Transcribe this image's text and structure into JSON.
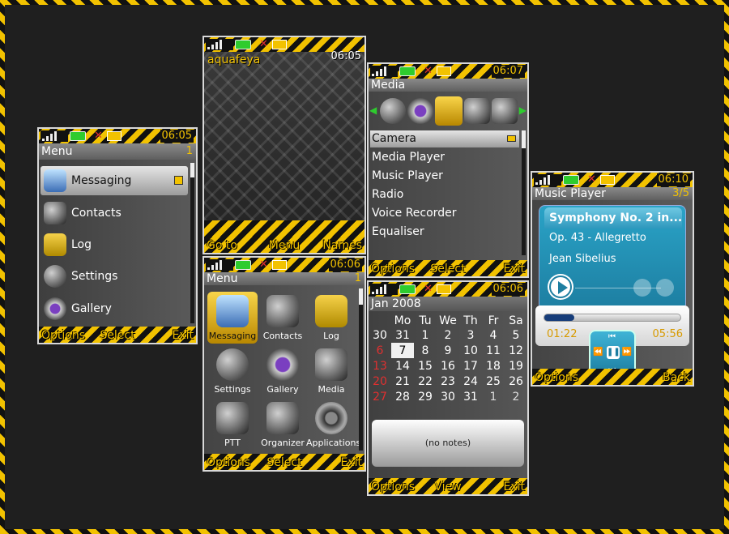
{
  "screen1": {
    "status_time": "06:05",
    "title": "Menu",
    "title_right": "1",
    "items": [
      {
        "label": "Messaging"
      },
      {
        "label": "Contacts"
      },
      {
        "label": "Log"
      },
      {
        "label": "Settings"
      },
      {
        "label": "Gallery"
      }
    ],
    "softkeys": {
      "left": "Options",
      "center": "Select",
      "right": "Exit"
    }
  },
  "screen2": {
    "status_time": "06:05",
    "operator": "aquafeya",
    "softkeys": {
      "left": "Go to",
      "center": "Menu",
      "right": "Names"
    }
  },
  "screen3": {
    "status_time": "06:06",
    "title": "Menu",
    "title_right": "1",
    "grid": [
      {
        "label": "Messaging"
      },
      {
        "label": "Contacts"
      },
      {
        "label": "Log"
      },
      {
        "label": "Settings"
      },
      {
        "label": "Gallery"
      },
      {
        "label": "Media"
      },
      {
        "label": "PTT"
      },
      {
        "label": "Organizer"
      },
      {
        "label": "Applications"
      }
    ],
    "softkeys": {
      "left": "Options",
      "center": "Select",
      "right": "Exit"
    }
  },
  "screen4": {
    "status_time": "06:07",
    "title": "Media",
    "items": [
      {
        "label": "Camera"
      },
      {
        "label": "Media Player"
      },
      {
        "label": "Music Player"
      },
      {
        "label": "Radio"
      },
      {
        "label": "Voice Recorder"
      },
      {
        "label": "Equaliser"
      }
    ],
    "softkeys": {
      "left": "Options",
      "center": "Select",
      "right": "Exit"
    }
  },
  "screen5": {
    "status_time": "06:06",
    "title": "Jan 2008",
    "weekdays": [
      "Mo",
      "Tu",
      "We",
      "Th",
      "Fr",
      "Sa"
    ],
    "weeks": [
      [
        "30",
        "31",
        "1",
        "2",
        "3",
        "4",
        "5"
      ],
      [
        "6",
        "7",
        "8",
        "9",
        "10",
        "11",
        "12"
      ],
      [
        "13",
        "14",
        "15",
        "16",
        "17",
        "18",
        "19"
      ],
      [
        "20",
        "21",
        "22",
        "23",
        "24",
        "25",
        "26"
      ],
      [
        "27",
        "28",
        "29",
        "30",
        "31",
        "1",
        "2"
      ]
    ],
    "notes": "(no notes)",
    "softkeys": {
      "left": "Options",
      "center": "View",
      "right": "Exit"
    }
  },
  "screen6": {
    "status_time": "06:10",
    "title": "Music Player",
    "title_right": "3/5",
    "track_title": "Symphony No. 2 in...",
    "track_sub": "Op. 43 - Allegretto",
    "artist": "Jean Sibelius",
    "elapsed": "01:22",
    "total": "05:56",
    "progress": 0.22,
    "softkeys": {
      "left": "Options",
      "center": "",
      "right": "Back"
    }
  },
  "colors": {
    "accent": "#f2c200",
    "hazard_dark": "#111111",
    "player_blue": "#2a9fc4"
  }
}
